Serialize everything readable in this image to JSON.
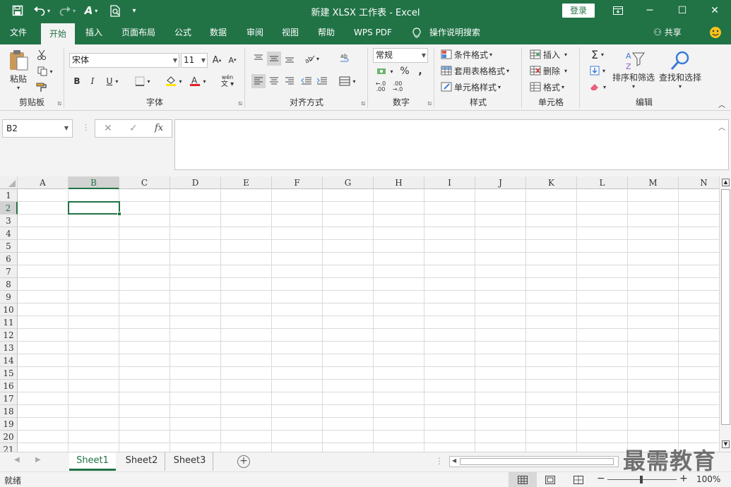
{
  "window": {
    "title": "新建 XLSX 工作表 - Excel",
    "login": "登录",
    "minimize": "─",
    "restore": "☐",
    "close": "✕",
    "ribbon_display": "⧈"
  },
  "quick_access": {
    "save": "💾",
    "undo": "↶",
    "redo": "↷",
    "format": "A",
    "preview": "🔍",
    "more": "▾"
  },
  "tabs": [
    "文件",
    "开始",
    "插入",
    "页面布局",
    "公式",
    "数据",
    "审阅",
    "视图",
    "帮助",
    "WPS PDF",
    "操作说明搜索"
  ],
  "tab_share": "共享",
  "clipboard": {
    "paste": "粘贴",
    "label": "剪贴板"
  },
  "font": {
    "name": "宋体",
    "size": "11",
    "label": "字体",
    "bold": "B",
    "italic": "I",
    "underline": "U",
    "grow": "A",
    "shrink": "A",
    "wen": "wén"
  },
  "alignment": {
    "label": "对齐方式"
  },
  "number": {
    "format": "常规",
    "percent": "%",
    "comma": ",",
    "label": "数字"
  },
  "styles": {
    "conditional": "条件格式",
    "table": "套用表格格式",
    "cell": "单元格样式",
    "label": "样式"
  },
  "cells": {
    "insert": "插入",
    "delete": "删除",
    "format": "格式",
    "label": "单元格"
  },
  "editing": {
    "sort": "排序和筛选",
    "find": "查找和选择",
    "label": "编辑"
  },
  "formula_bar": {
    "name_box": "B2",
    "cancel": "✕",
    "enter": "✓",
    "fx": "fx",
    "content": ""
  },
  "columns": [
    "A",
    "B",
    "C",
    "D",
    "E",
    "F",
    "G",
    "H",
    "I",
    "J",
    "K",
    "L",
    "M",
    "N"
  ],
  "rows": [
    "1",
    "2",
    "3",
    "4",
    "5",
    "6",
    "7",
    "8",
    "9",
    "10",
    "11",
    "12",
    "13",
    "14",
    "15",
    "16",
    "17",
    "18",
    "19",
    "20",
    "21"
  ],
  "selected_cell": "B2",
  "sheets": [
    "Sheet1",
    "Sheet2",
    "Sheet3"
  ],
  "active_sheet": "Sheet1",
  "status": {
    "ready": "就绪",
    "zoom": "100%",
    "zoom_minus": "−",
    "zoom_plus": "+"
  },
  "watermark": "最需教育"
}
